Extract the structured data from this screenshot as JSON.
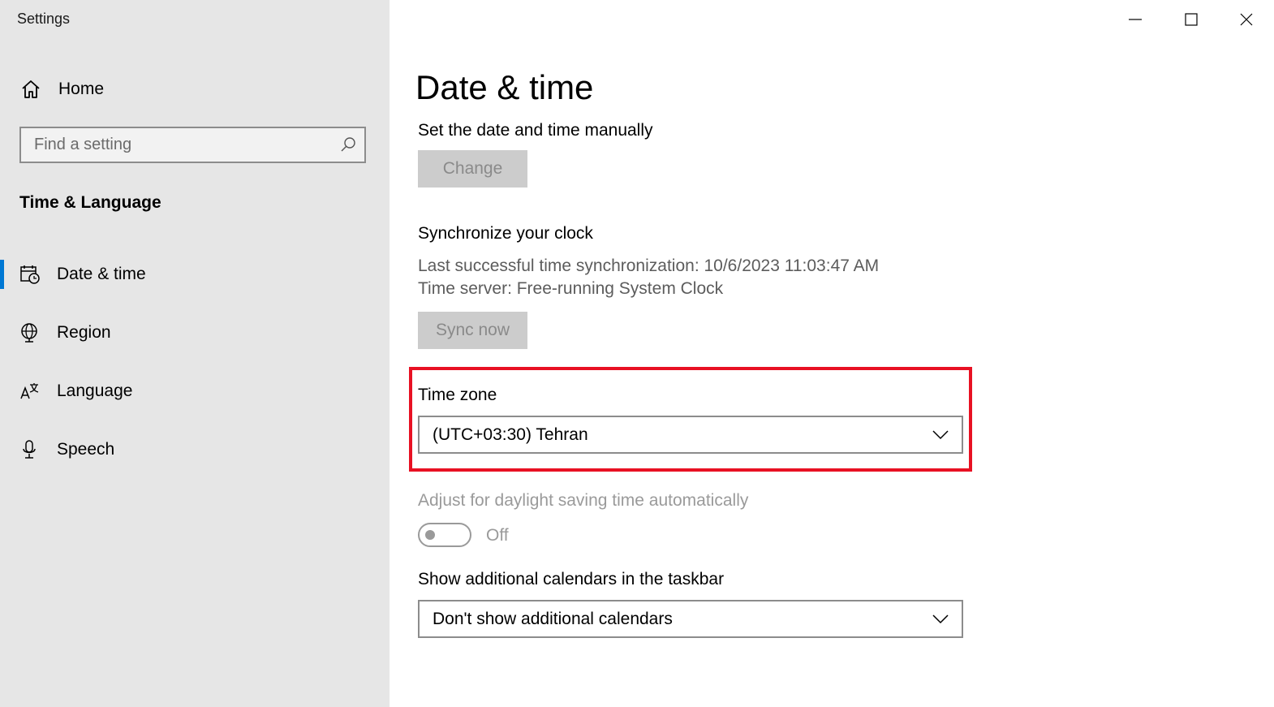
{
  "window": {
    "title": "Settings",
    "controls": {
      "minimize": "minimize",
      "maximize": "maximize",
      "close": "close"
    }
  },
  "sidebar": {
    "home_label": "Home",
    "search_placeholder": "Find a setting",
    "section_title": "Time & Language",
    "items": [
      {
        "label": "Date & time",
        "icon": "calendar-clock-icon",
        "active": true
      },
      {
        "label": "Region",
        "icon": "globe-icon",
        "active": false
      },
      {
        "label": "Language",
        "icon": "language-icon",
        "active": false
      },
      {
        "label": "Speech",
        "icon": "microphone-icon",
        "active": false
      }
    ],
    "accent_color": "#0078d4"
  },
  "main": {
    "title": "Date & time",
    "manual": {
      "label": "Set the date and time manually",
      "button": "Change"
    },
    "sync": {
      "label": "Synchronize your clock",
      "last_sync": "Last successful time synchronization: 10/6/2023 11:03:47 AM",
      "server": "Time server: Free-running System Clock",
      "button": "Sync now"
    },
    "timezone": {
      "label": "Time zone",
      "value": "(UTC+03:30) Tehran",
      "highlight_color": "#e81123"
    },
    "dst": {
      "label": "Adjust for daylight saving time automatically",
      "state": "Off"
    },
    "calendars": {
      "label": "Show additional calendars in the taskbar",
      "value": "Don't show additional calendars"
    }
  }
}
